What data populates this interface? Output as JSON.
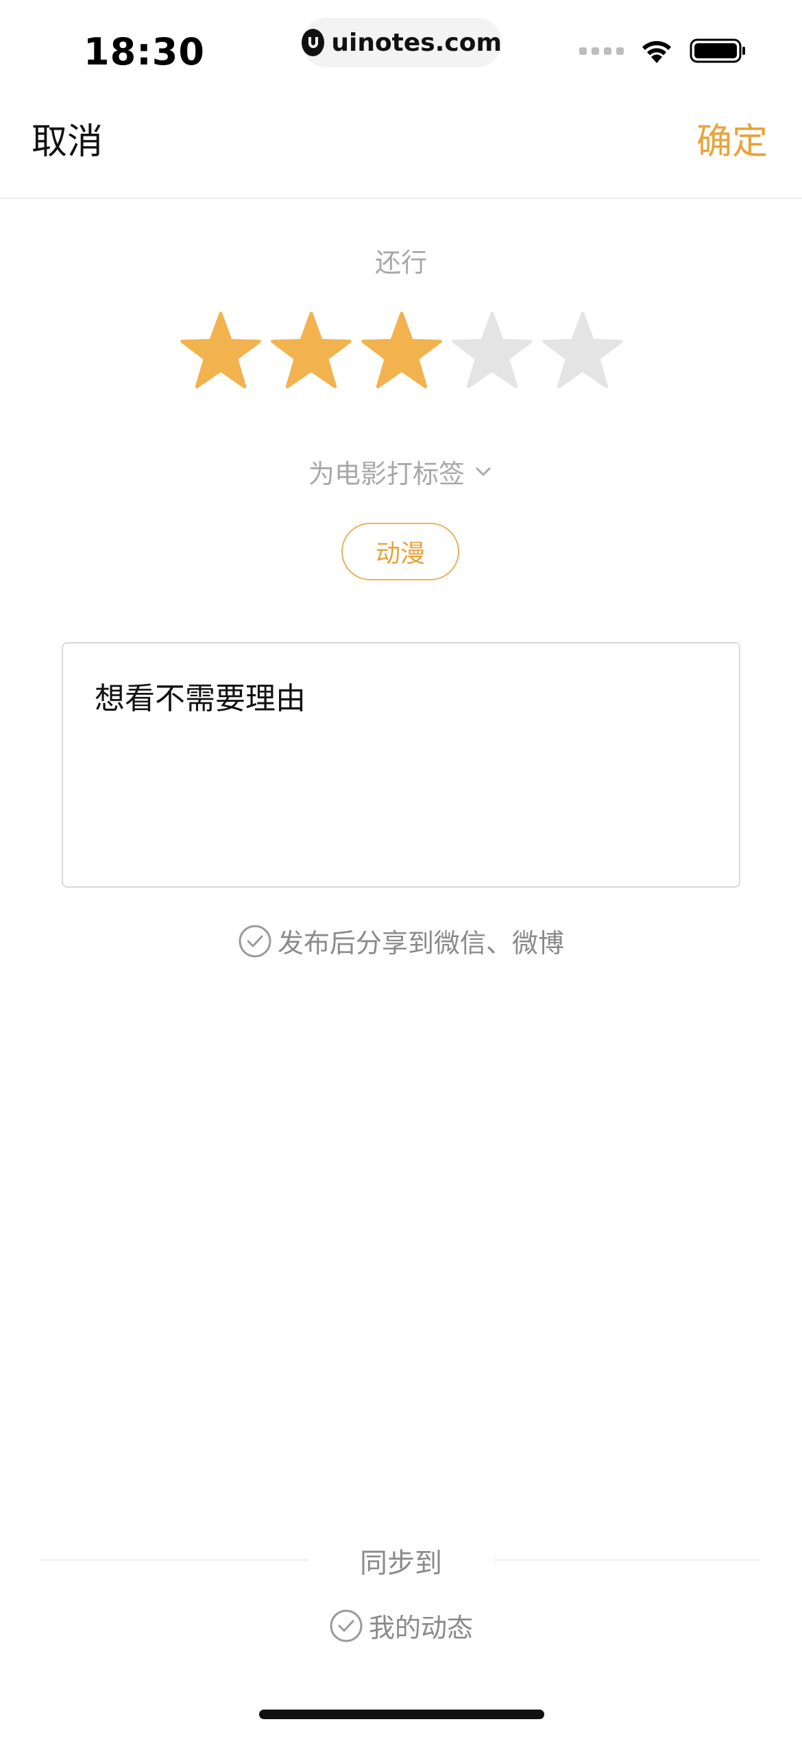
{
  "status_bar": {
    "time": "18:30",
    "url": "uinotes.com"
  },
  "nav": {
    "cancel_label": "取消",
    "confirm_label": "确定"
  },
  "rating": {
    "label": "还行",
    "value": 3,
    "max": 5,
    "active_color": "#F2B24E",
    "inactive_color": "#E4E4E4"
  },
  "tags": {
    "toggle_label": "为电影打标签",
    "items": [
      "动漫"
    ]
  },
  "comment": {
    "text": "想看不需要理由"
  },
  "share": {
    "label": "发布后分享到微信、微博"
  },
  "sync": {
    "title": "同步到",
    "option_label": "我的动态"
  },
  "colors": {
    "accent": "#E8A33B",
    "muted_text": "#8A8A8A",
    "placeholder_text": "#A8A8A8"
  }
}
